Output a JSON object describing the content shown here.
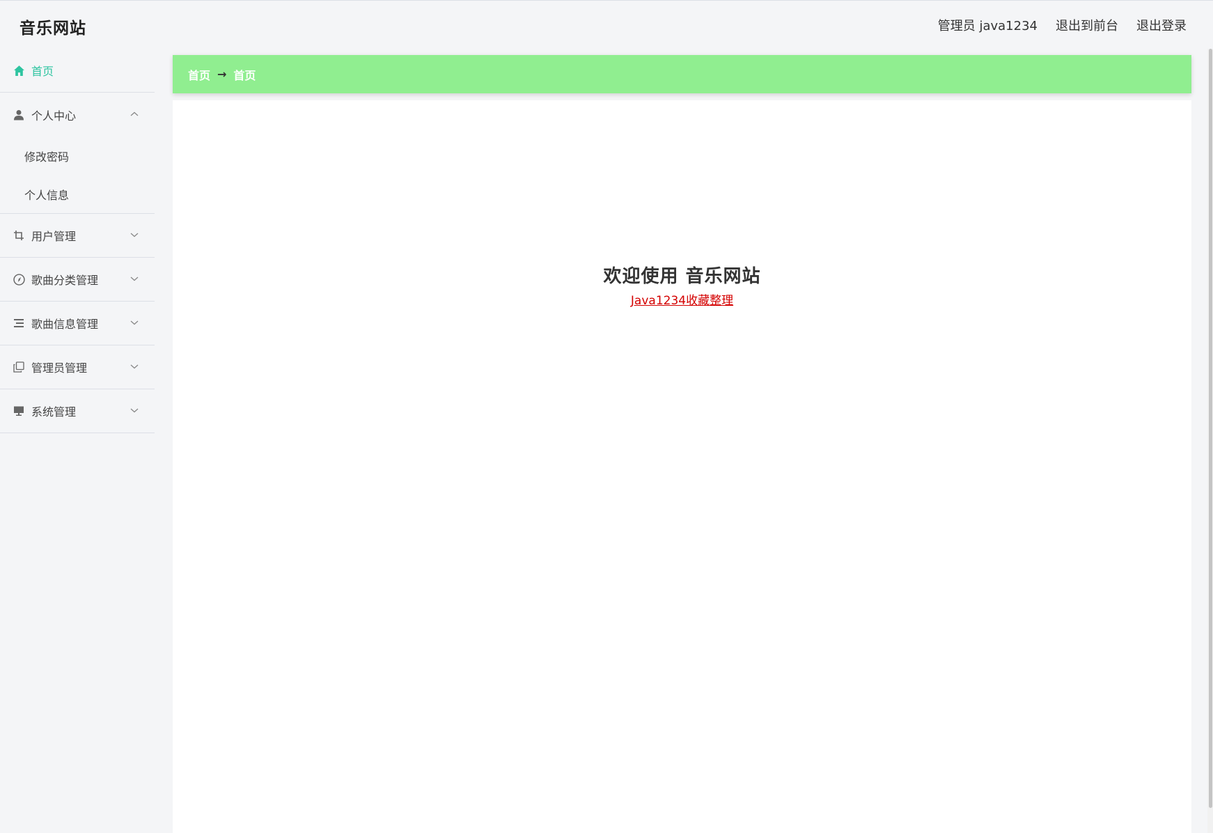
{
  "header": {
    "brand": "音乐网站",
    "admin_label": "管理员 java1234",
    "back_to_front": "退出到前台",
    "logout": "退出登录"
  },
  "sidebar": {
    "items": [
      {
        "label": "首页",
        "icon": "home-icon",
        "active": true
      },
      {
        "label": "个人中心",
        "icon": "user-icon",
        "expanded": true,
        "children": [
          {
            "label": "修改密码"
          },
          {
            "label": "个人信息"
          }
        ]
      },
      {
        "label": "用户管理",
        "icon": "crop-icon"
      },
      {
        "label": "歌曲分类管理",
        "icon": "compass-icon"
      },
      {
        "label": "歌曲信息管理",
        "icon": "list-icon"
      },
      {
        "label": "管理员管理",
        "icon": "copy-icon"
      },
      {
        "label": "系统管理",
        "icon": "monitor-icon"
      }
    ]
  },
  "breadcrumb": {
    "first": "首页",
    "separator": "→",
    "second": "首页"
  },
  "main": {
    "welcome_title": "欢迎使用 音乐网站",
    "link_text": "Java1234收藏整理"
  },
  "colors": {
    "accent": "#2ec4a0",
    "breadcrumb_bg": "#90ee90",
    "link": "#d40000"
  }
}
